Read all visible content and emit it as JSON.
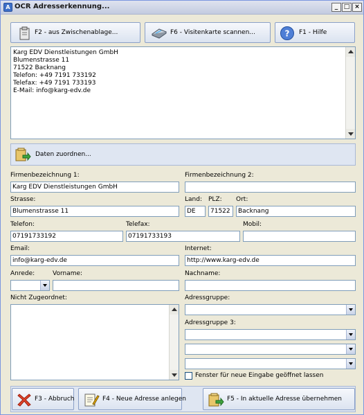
{
  "window": {
    "title": "OCR Adresserkennung...",
    "icon_text": "A"
  },
  "toolbar": {
    "clipboard_label": "F2 - aus Zwischenablage...",
    "scan_label": "F6 - Visitenkarte scannen...",
    "help_label": "F1 - Hilfe"
  },
  "ocr_text": [
    "Karg EDV Dienstleistungen GmbH",
    "Blumenstrasse 11",
    "71522 Backnang",
    "Telefon: +49 7191 733192",
    "Telefax: +49 7191 733193",
    "E-Mail: info@karg-edv.de"
  ],
  "assign": {
    "label": "Daten zuordnen..."
  },
  "form": {
    "firma1": {
      "label": "Firmenbezeichnung 1:",
      "value": "Karg EDV Dienstleistungen GmbH"
    },
    "firma2": {
      "label": "Firmenbezeichnung 2:",
      "value": ""
    },
    "strasse": {
      "label": "Strasse:",
      "value": "Blumenstrasse 11"
    },
    "land": {
      "label": "Land:",
      "value": "DE"
    },
    "plz": {
      "label": "PLZ:",
      "value": "71522"
    },
    "ort": {
      "label": "Ort:",
      "value": "Backnang"
    },
    "telefon": {
      "label": "Telefon:",
      "value": "07191733192"
    },
    "telefax": {
      "label": "Telefax:",
      "value": "07191733193"
    },
    "mobil": {
      "label": "Mobil:",
      "value": ""
    },
    "email": {
      "label": "Email:",
      "value": "info@karg-edv.de"
    },
    "internet": {
      "label": "Internet:",
      "value": "http://www.karg-edv.de"
    },
    "anrede": {
      "label": "Anrede:",
      "value": ""
    },
    "vorname": {
      "label": "Vorname:",
      "value": ""
    },
    "nachname": {
      "label": "Nachname:",
      "value": ""
    },
    "nicht_zugeordnet": {
      "label": "Nicht Zugeordnet:"
    },
    "adressgruppe": {
      "label": "Adressgruppe:",
      "value": ""
    },
    "adressgruppe3": {
      "label": "Adressgruppe 3:"
    },
    "keep_open": {
      "label": "Fenster für neue Eingabe geöffnet lassen",
      "checked": false
    }
  },
  "footer": {
    "cancel_label": "F3 - Abbruch",
    "new_label": "F4 - Neue Adresse anlegen",
    "apply_label": "F5 - In aktuelle Adresse übernehmen"
  },
  "colors": {
    "panel": "#dfe6f2",
    "field_border": "#7f9db9",
    "titlebar": "#c3cbe0"
  }
}
